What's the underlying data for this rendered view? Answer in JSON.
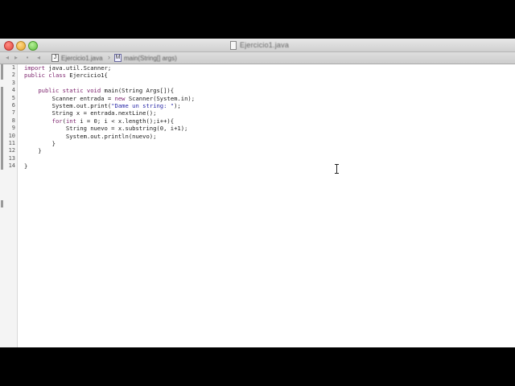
{
  "window": {
    "title": "Ejercicio1.java"
  },
  "toolbar": {
    "breadcrumbs": [
      {
        "icon": "java-file-icon",
        "label": "Ejercicio1.java"
      },
      {
        "icon": "method-icon",
        "label": "main(String[] args)"
      }
    ]
  },
  "editor": {
    "line_numbers": [
      "1",
      "2",
      "3",
      "4",
      "5",
      "6",
      "7",
      "8",
      "9",
      "10",
      "11",
      "12",
      "13",
      "14"
    ],
    "lines": [
      [
        {
          "t": "import",
          "c": "kw"
        },
        {
          "t": " java.util.Scanner;"
        }
      ],
      [
        {
          "t": "public",
          "c": "kw"
        },
        {
          "t": " "
        },
        {
          "t": "class",
          "c": "kw"
        },
        {
          "t": " Ejercicio1{"
        }
      ],
      [
        {
          "t": ""
        }
      ],
      [
        {
          "t": "    "
        },
        {
          "t": "public",
          "c": "kw"
        },
        {
          "t": " "
        },
        {
          "t": "static",
          "c": "kw"
        },
        {
          "t": " "
        },
        {
          "t": "void",
          "c": "kw"
        },
        {
          "t": " main(String Args[]){"
        }
      ],
      [
        {
          "t": "        Scanner entrada = "
        },
        {
          "t": "new",
          "c": "kw"
        },
        {
          "t": " Scanner(System.in);"
        }
      ],
      [
        {
          "t": "        System.out.print("
        },
        {
          "t": "\"Dame un string: \"",
          "c": "str"
        },
        {
          "t": ");"
        }
      ],
      [
        {
          "t": "        String x = entrada.nextLine();"
        }
      ],
      [
        {
          "t": "        "
        },
        {
          "t": "for",
          "c": "kw"
        },
        {
          "t": "("
        },
        {
          "t": "int",
          "c": "kw"
        },
        {
          "t": " i = 0; i < x.length();i++){"
        }
      ],
      [
        {
          "t": "            String nuevo = x.substring(0, i+1);"
        }
      ],
      [
        {
          "t": "            System.out.println(nuevo);"
        }
      ],
      [
        {
          "t": "        }"
        }
      ],
      [
        {
          "t": "    }"
        }
      ],
      [
        {
          "t": ""
        }
      ],
      [
        {
          "t": "}"
        }
      ]
    ]
  }
}
